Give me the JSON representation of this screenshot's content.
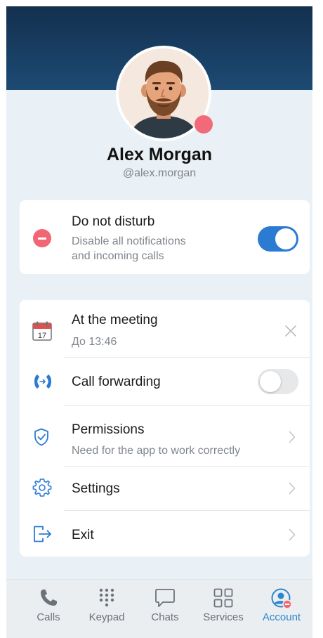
{
  "profile": {
    "name": "Alex Morgan",
    "handle": "@alex.morgan"
  },
  "dnd": {
    "title": "Do not disturb",
    "description_line1": "Disable all notifications",
    "description_line2": "and incoming calls",
    "enabled": true
  },
  "status_item": {
    "title": "At the meeting",
    "subtitle": "До 13:46",
    "calendar_day": "17"
  },
  "call_forwarding": {
    "title": "Call forwarding",
    "enabled": false
  },
  "permissions": {
    "title": "Permissions",
    "subtitle": "Need for the app to work correctly"
  },
  "settings": {
    "title": "Settings"
  },
  "exit": {
    "title": "Exit"
  },
  "tabs": [
    {
      "label": "Calls",
      "icon": "phone-icon"
    },
    {
      "label": "Keypad",
      "icon": "keypad-icon"
    },
    {
      "label": "Chats",
      "icon": "chat-icon"
    },
    {
      "label": "Services",
      "icon": "grid-icon"
    },
    {
      "label": "Account",
      "icon": "account-icon",
      "active": true
    }
  ],
  "colors": {
    "accent": "#2b7bd3",
    "danger": "#f06674",
    "header": "#13304f"
  }
}
